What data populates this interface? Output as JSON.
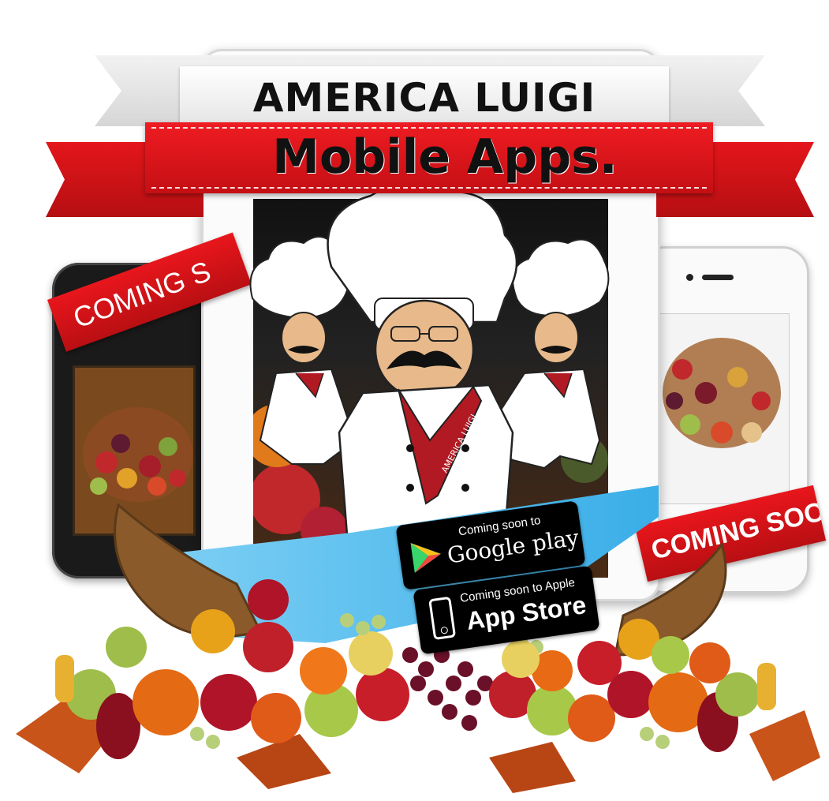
{
  "banner": {
    "title_top": "AMERICA LUIGI",
    "title_main": "Mobile Apps."
  },
  "ribbons": {
    "left_text": "COMING S",
    "right_text": "COMING SOON"
  },
  "chef": {
    "apron_text": "AMERICA LUIGI"
  },
  "stores": {
    "google": {
      "sub": "Coming soon to",
      "main": "Google play"
    },
    "apple": {
      "sub": "Coming soon to Apple",
      "main": "App Store"
    }
  },
  "colors": {
    "banner_red": "#e4161b",
    "swoosh_blue": "#5bc0ee",
    "badge_black": "#000000"
  }
}
